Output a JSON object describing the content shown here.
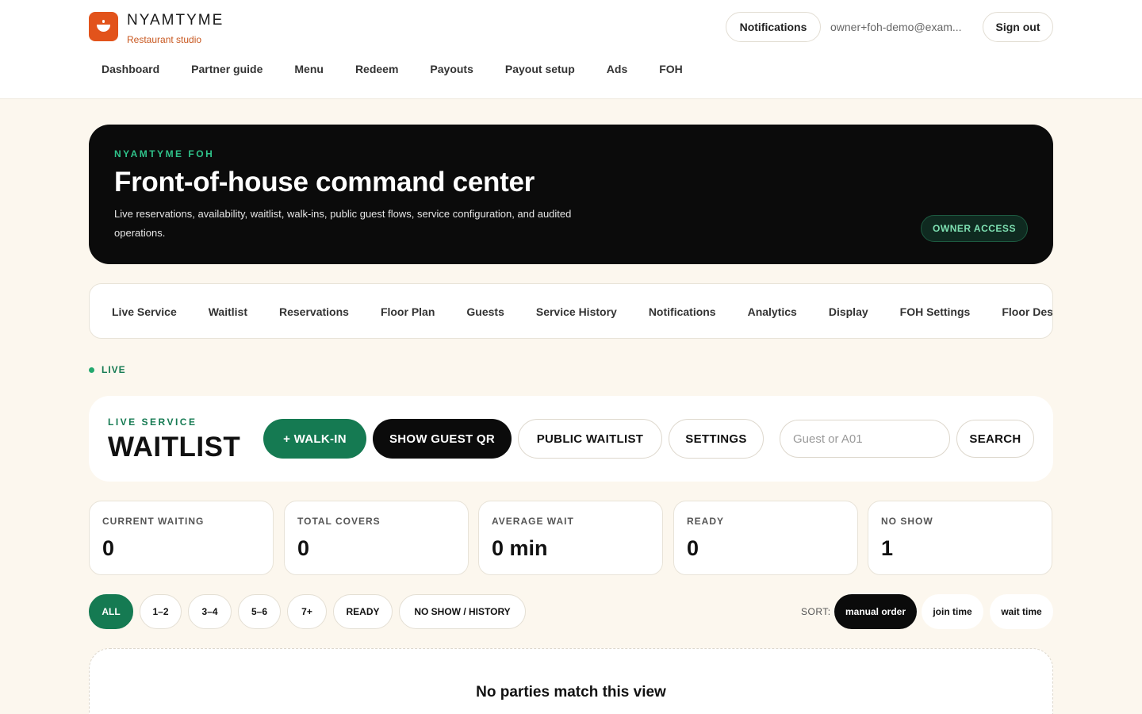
{
  "brand": {
    "name": "NYAMTYME",
    "subtitle": "Restaurant studio"
  },
  "header": {
    "notifications_label": "Notifications",
    "user_email": "owner+foh-demo@exam...",
    "signout_label": "Sign out"
  },
  "nav": {
    "items": [
      "Dashboard",
      "Partner guide",
      "Menu",
      "Redeem",
      "Payouts",
      "Payout setup",
      "Ads",
      "FOH"
    ]
  },
  "hero": {
    "eyebrow": "NYAMTYME FOH",
    "title": "Front-of-house command center",
    "description": "Live reservations, availability, waitlist, walk-ins, public guest flows, service configuration, and audited operations.",
    "badge": "OWNER ACCESS"
  },
  "subtabs": {
    "items": [
      "Live Service",
      "Waitlist",
      "Reservations",
      "Floor Plan",
      "Guests",
      "Service History",
      "Notifications",
      "Analytics",
      "Display",
      "FOH Settings",
      "Floor Designer"
    ]
  },
  "status": {
    "live_label": "LIVE"
  },
  "toolbar": {
    "eyebrow": "LIVE SERVICE",
    "title": "WAITLIST",
    "walkin_label": "+ WALK-IN",
    "qr_label": "SHOW GUEST QR",
    "public_label": "PUBLIC WAITLIST",
    "settings_label": "SETTINGS",
    "search_placeholder": "Guest or A01",
    "search_label": "SEARCH"
  },
  "stats": [
    {
      "label": "CURRENT WAITING",
      "value": "0"
    },
    {
      "label": "TOTAL COVERS",
      "value": "0"
    },
    {
      "label": "AVERAGE WAIT",
      "value": "0 min"
    },
    {
      "label": "READY",
      "value": "0"
    },
    {
      "label": "NO SHOW",
      "value": "1"
    }
  ],
  "filters": {
    "chips": [
      "ALL",
      "1–2",
      "3–4",
      "5–6",
      "7+",
      "READY",
      "NO SHOW / HISTORY"
    ],
    "active": "ALL",
    "sort_label": "SORT:",
    "sort_options": [
      "manual order",
      "join time",
      "wait time"
    ],
    "sort_active": "manual order"
  },
  "empty": {
    "message": "No parties match this view"
  },
  "colors": {
    "accent_green": "#157a52",
    "brand_orange": "#e2531b",
    "hero_bg": "#0b0b0b",
    "page_bg": "#fcf7ee"
  }
}
